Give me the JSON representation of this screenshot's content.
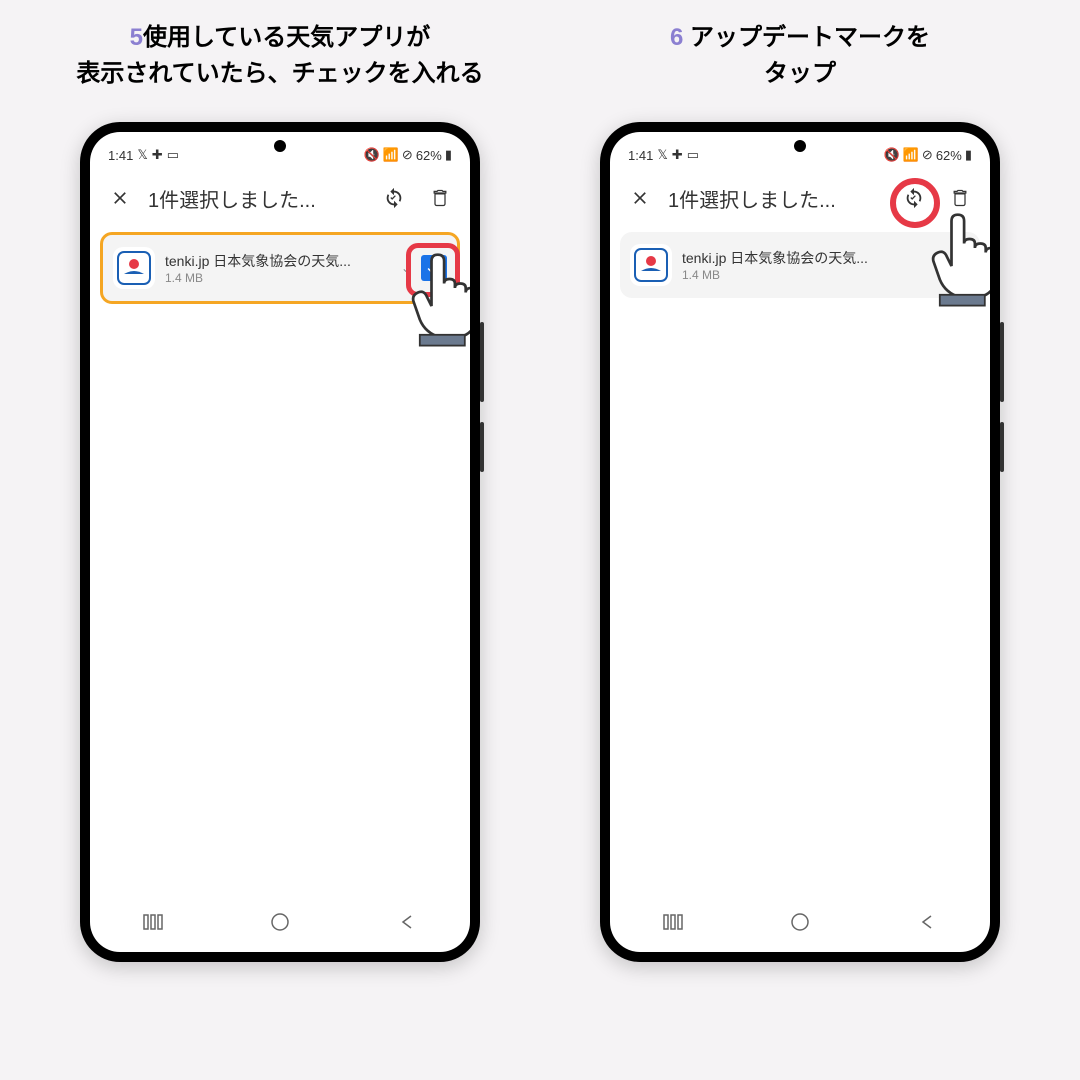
{
  "steps": [
    {
      "number": "5",
      "title_line1": "使用している天気アプリが",
      "title_line2": "表示されていたら、チェックを入れる"
    },
    {
      "number": "6",
      "title_line1": "アップデートマークを",
      "title_line2": "タップ"
    }
  ],
  "status_bar": {
    "time": "1:41",
    "battery": "62%"
  },
  "app_bar": {
    "title": "1件選択しました..."
  },
  "app_item": {
    "name": "tenki.jp 日本気象協会の天気...",
    "size": "1.4 MB"
  }
}
